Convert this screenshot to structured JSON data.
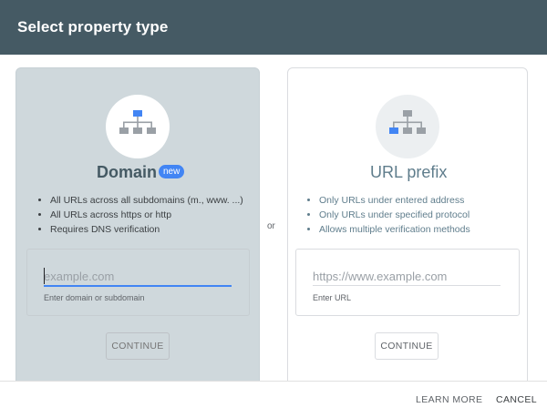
{
  "dialog": {
    "title": "Select property type",
    "or_label": "or"
  },
  "domain_card": {
    "title": "Domain",
    "badge": "new",
    "icon": "sitemap-icon",
    "bullets": [
      "All URLs across all subdomains (m., www. ...)",
      "All URLs across https or http",
      "Requires DNS verification"
    ],
    "input_placeholder": "example.com",
    "input_value": "",
    "input_hint": "Enter domain or subdomain",
    "continue_label": "CONTINUE"
  },
  "url_prefix_card": {
    "title": "URL prefix",
    "icon": "sitemap-icon",
    "bullets": [
      "Only URLs under entered address",
      "Only URLs under specified protocol",
      "Allows multiple verification methods"
    ],
    "input_placeholder": "https://www.example.com",
    "input_value": "",
    "input_hint": "Enter URL",
    "continue_label": "CONTINUE"
  },
  "footer": {
    "learn_more_label": "LEARN MORE",
    "cancel_label": "CANCEL"
  },
  "colors": {
    "header_bg": "#455a64",
    "selected_card_bg": "#cfd8dc",
    "accent_blue": "#4285f4"
  }
}
